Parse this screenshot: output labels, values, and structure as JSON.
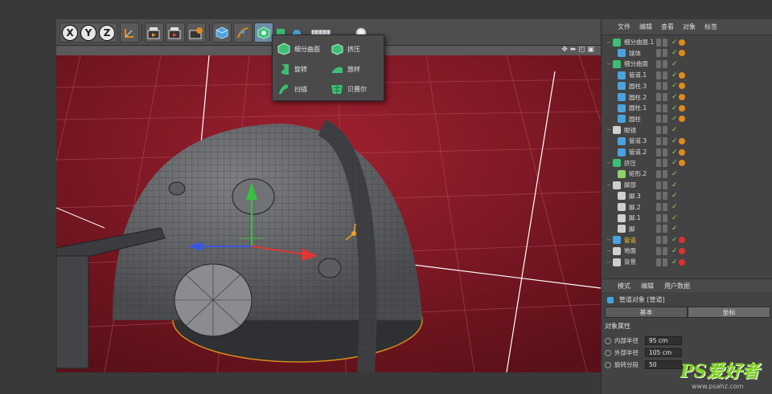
{
  "toolbar": {
    "axes": [
      "X",
      "Y",
      "Z"
    ],
    "icons": [
      "coordinate-system-icon",
      "render-view-icon",
      "render-picture-viewer-icon",
      "render-settings-icon",
      "cube-icon",
      "pen-icon",
      "subdivision-surface-icon",
      "extrude-icon",
      "camera-icon",
      "floor-icon",
      "light-icon"
    ]
  },
  "popup": {
    "items": [
      {
        "label": "细分曲面",
        "icon": "subdivision-surface-icon",
        "color": "#3cbf74"
      },
      {
        "label": "挤压",
        "icon": "extrude-icon",
        "color": "#3cbf74"
      },
      {
        "label": "旋转",
        "icon": "lathe-icon",
        "color": "#3cbf74"
      },
      {
        "label": "放样",
        "icon": "loft-icon",
        "color": "#3cbf74"
      },
      {
        "label": "扫描",
        "icon": "sweep-icon",
        "color": "#3cbf74"
      },
      {
        "label": "贝赛尔",
        "icon": "bezier-icon",
        "color": "#3cbf74"
      }
    ]
  },
  "viewport": {
    "nav_icons": "✥ ⬌ ◰ ▣"
  },
  "objects_menu": [
    "文件",
    "编辑",
    "查看",
    "对象",
    "标签"
  ],
  "tree": [
    {
      "label": "细分曲面.1",
      "depth": 0,
      "icon": "subdivision-surface-icon",
      "icolor": "#3cbf74",
      "tag": "#e08a1e"
    },
    {
      "label": "球体",
      "depth": 1,
      "icon": "sphere-icon",
      "icolor": "#4aa3df",
      "tag": "#e08a1e"
    },
    {
      "label": "细分曲面",
      "depth": 0,
      "icon": "subdivision-surface-icon",
      "icolor": "#3cbf74",
      "tag": ""
    },
    {
      "label": "管道.1",
      "depth": 1,
      "icon": "tube-icon",
      "icolor": "#4aa3df",
      "tag": "#e08a1e"
    },
    {
      "label": "圆柱.3",
      "depth": 1,
      "icon": "cylinder-icon",
      "icolor": "#4aa3df",
      "tag": "#e08a1e"
    },
    {
      "label": "圆柱.2",
      "depth": 1,
      "icon": "cylinder-icon",
      "icolor": "#4aa3df",
      "tag": "#e08a1e"
    },
    {
      "label": "圆柱.1",
      "depth": 1,
      "icon": "cylinder-icon",
      "icolor": "#4aa3df",
      "tag": "#e08a1e"
    },
    {
      "label": "圆柱",
      "depth": 1,
      "icon": "cylinder-icon",
      "icolor": "#4aa3df",
      "tag": "#e08a1e"
    },
    {
      "label": "眼镜",
      "depth": 0,
      "icon": "null-icon",
      "icolor": "#cfcfcf",
      "tag": ""
    },
    {
      "label": "管道.3",
      "depth": 1,
      "icon": "tube-icon",
      "icolor": "#4aa3df",
      "tag": "#e08a1e"
    },
    {
      "label": "管道.2",
      "depth": 1,
      "icon": "tube-icon",
      "icolor": "#4aa3df",
      "tag": "#e08a1e"
    },
    {
      "label": "挤压",
      "depth": 0,
      "icon": "extrude-icon",
      "icolor": "#3cbf74",
      "tag": "#e08a1e"
    },
    {
      "label": "矩形.2",
      "depth": 1,
      "icon": "spline-icon",
      "icolor": "#8fd16a",
      "tag": ""
    },
    {
      "label": "脚部",
      "depth": 0,
      "icon": "null-icon",
      "icolor": "#cfcfcf",
      "tag": ""
    },
    {
      "label": "脚.3",
      "depth": 1,
      "icon": "null-icon",
      "icolor": "#cfcfcf",
      "tag": ""
    },
    {
      "label": "脚.2",
      "depth": 1,
      "icon": "null-icon",
      "icolor": "#cfcfcf",
      "tag": ""
    },
    {
      "label": "脚.1",
      "depth": 1,
      "icon": "null-icon",
      "icolor": "#cfcfcf",
      "tag": ""
    },
    {
      "label": "脚",
      "depth": 1,
      "icon": "null-icon",
      "icolor": "#cfcfcf",
      "tag": ""
    },
    {
      "label": "管道",
      "depth": 0,
      "icon": "tube-icon",
      "icolor": "#4aa3df",
      "tag": "#e03030",
      "selected": true
    },
    {
      "label": "地面",
      "depth": 0,
      "icon": "floor-icon",
      "icolor": "#cfcfcf",
      "tag": "#e03030"
    },
    {
      "label": "背景",
      "depth": 0,
      "icon": "background-icon",
      "icolor": "#cfcfcf",
      "tag": "#e03030"
    }
  ],
  "attributes": {
    "menu": [
      "模式",
      "编辑",
      "用户数据"
    ],
    "title": "管道对象 [管道]",
    "tabs": [
      "基本",
      "坐标"
    ],
    "section": "对象属性",
    "fields": [
      {
        "label": "内部半径",
        "value": "95 cm"
      },
      {
        "label": "外部半径",
        "value": "105 cm"
      },
      {
        "label": "旋转分段",
        "value": "50"
      }
    ]
  },
  "watermark": {
    "brand": "PS爱好者",
    "url": "www.psahz.com"
  }
}
